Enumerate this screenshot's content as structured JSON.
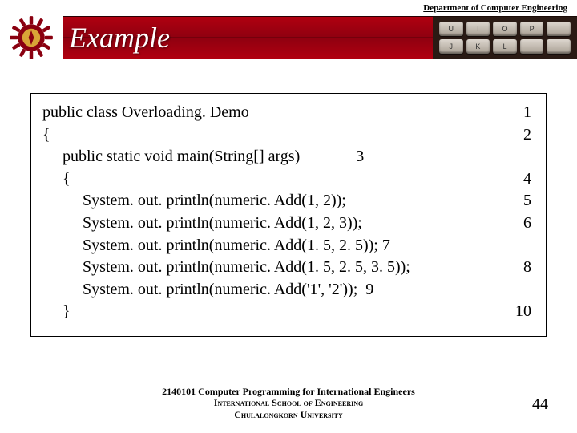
{
  "header": {
    "department": "Department of Computer Engineering",
    "title": "Example"
  },
  "keyboard_keys": [
    "U",
    "I",
    "O",
    "P",
    "",
    "J",
    "K",
    "L",
    "",
    ""
  ],
  "code": {
    "lines": [
      {
        "text": "public class Overloading. Demo",
        "num": "1",
        "pos": "right"
      },
      {
        "text": "{",
        "num": "2",
        "pos": "right"
      },
      {
        "text": "     public static void main(String[] args)              ",
        "num": "3",
        "pos": "inline"
      },
      {
        "text": "     {",
        "num": "4",
        "pos": "right"
      },
      {
        "text": "          System. out. println(numeric. Add(1, 2));",
        "num": "5",
        "pos": "right"
      },
      {
        "text": "          System. out. println(numeric. Add(1, 2, 3));",
        "num": "6",
        "pos": "right"
      },
      {
        "text": "          System. out. println(numeric. Add(1. 5, 2. 5)); ",
        "num": "7",
        "pos": "inline"
      },
      {
        "text": "          System. out. println(numeric. Add(1. 5, 2. 5, 3. 5));",
        "num": "8",
        "pos": "right"
      },
      {
        "text": "          System. out. println(numeric. Add('1', '2'));  ",
        "num": "9",
        "pos": "inline"
      },
      {
        "text": "     }",
        "num": "10",
        "pos": "right"
      }
    ]
  },
  "footer": {
    "line1": "2140101 Computer Programming for International Engineers",
    "line2": "International School of Engineering",
    "line3": "Chulalongkorn University"
  },
  "page_number": "44"
}
